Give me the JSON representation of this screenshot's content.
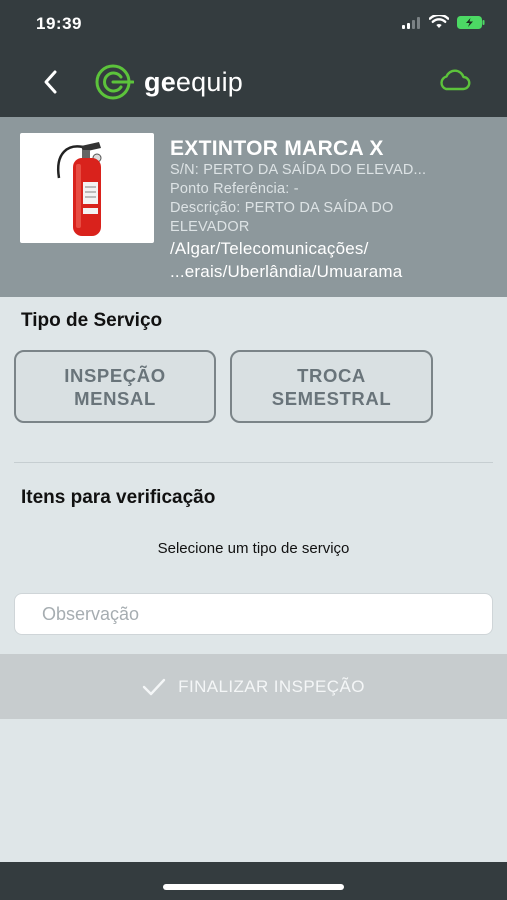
{
  "status_bar": {
    "time": "19:39"
  },
  "header": {
    "brand_bold": "ge",
    "brand_rest": "equip"
  },
  "equipment": {
    "name": "EXTINTOR MARCA X",
    "serial": "S/N: PERTO DA SAÍDA DO ELEVAD...",
    "reference_point": "Ponto Referência: -",
    "description_line1": "Descrição: PERTO DA SAÍDA DO",
    "description_line2": "ELEVADOR",
    "path_line1": "/Algar/Telecomunicações/",
    "path_line2": "...erais/Uberlândia/Umuarama"
  },
  "service_type": {
    "title": "Tipo de Serviço",
    "options": [
      {
        "line1": "INSPEÇÃO",
        "line2": "MENSAL"
      },
      {
        "line1": "TROCA",
        "line2": "SEMESTRAL"
      }
    ]
  },
  "verification": {
    "title": "Itens para verificação",
    "hint": "Selecione um tipo de serviço"
  },
  "observation": {
    "placeholder": "Observação",
    "value": ""
  },
  "finalize": {
    "label": "FINALIZAR INSPEÇÃO"
  },
  "colors": {
    "header_bg": "#343c3f",
    "brand_green": "#5cc33b",
    "card_bg": "#8d989c",
    "page_bg": "#dfe6e8"
  },
  "icons": {
    "back": "chevron-left-icon",
    "logo": "geequip-logo-icon",
    "cloud": "cloud-icon",
    "check": "check-icon"
  }
}
